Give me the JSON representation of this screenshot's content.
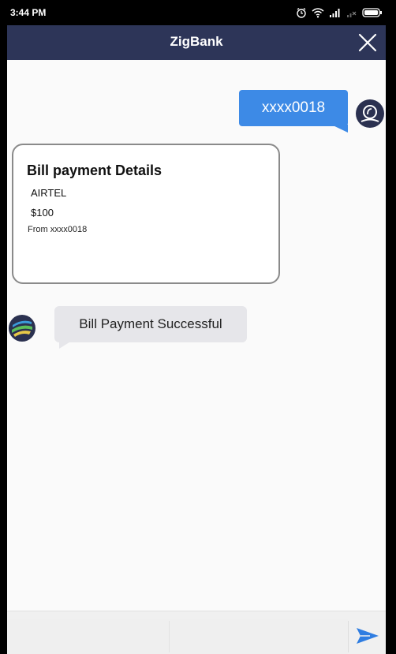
{
  "status_bar": {
    "time": "3:44 PM"
  },
  "header": {
    "title": "ZigBank"
  },
  "chat": {
    "user_message": "xxxx0018",
    "bill_card": {
      "title": "Bill payment Details",
      "biller": "AIRTEL",
      "amount": "$100",
      "from": "From xxxx0018"
    },
    "bot_message": "Bill Payment Successful"
  },
  "input": {
    "placeholder": ""
  },
  "colors": {
    "header_bg": "#2d3558",
    "user_bubble": "#3d8ae6",
    "bot_bubble": "#e6e6ea",
    "send_icon": "#2f7de1"
  },
  "icons": {
    "close": "close-icon",
    "send": "send-icon",
    "user_avatar": "user-avatar-icon",
    "bot_avatar": "bot-logo-icon",
    "alarm": "alarm-icon",
    "wifi": "wifi-icon",
    "signal": "signal-icon",
    "battery": "battery-icon"
  }
}
